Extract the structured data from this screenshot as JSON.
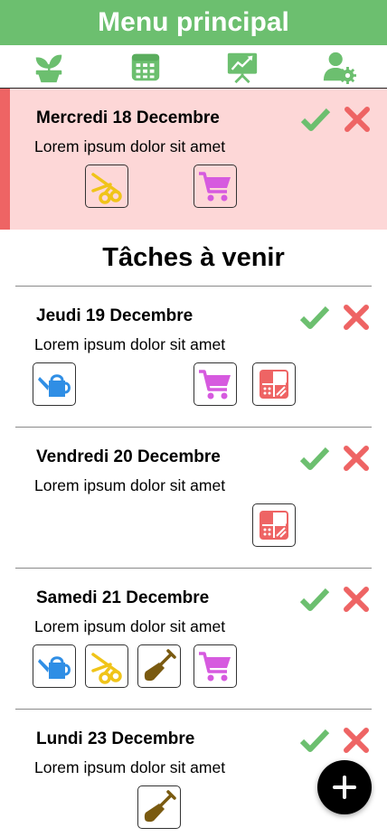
{
  "header": {
    "title": "Menu principal",
    "color": "#6cbf6f"
  },
  "nav": [
    {
      "icon": "plant-icon"
    },
    {
      "icon": "calendar-icon"
    },
    {
      "icon": "chart-icon"
    },
    {
      "icon": "user-settings-icon"
    }
  ],
  "today": {
    "date": "Mercredi 18 Decembre",
    "description": "Lorem ipsum dolor sit amet",
    "tools": [
      "scissors-icon",
      "cart-icon"
    ],
    "background": "#fdd7d7",
    "accent": "#ee6464"
  },
  "upcoming_title": "Tâches à venir",
  "tasks": [
    {
      "date": "Jeudi 19 Decembre",
      "description": "Lorem ipsum dolor sit amet",
      "tools": [
        "watering-can-icon",
        "cart-icon",
        "calculator-icon"
      ]
    },
    {
      "date": "Vendredi 20 Decembre",
      "description": "Lorem ipsum dolor sit amet",
      "tools": [
        "calculator-icon"
      ]
    },
    {
      "date": "Samedi 21 Decembre",
      "description": "Lorem ipsum dolor sit amet",
      "tools": [
        "watering-can-icon",
        "scissors-icon",
        "shovel-icon",
        "cart-icon"
      ]
    },
    {
      "date": "Lundi 23 Decembre",
      "description": "Lorem ipsum dolor sit amet",
      "tools": [
        "shovel-icon"
      ]
    }
  ],
  "colors": {
    "check": "#6cbf6f",
    "cross": "#ee6464",
    "fab": "#000000"
  }
}
